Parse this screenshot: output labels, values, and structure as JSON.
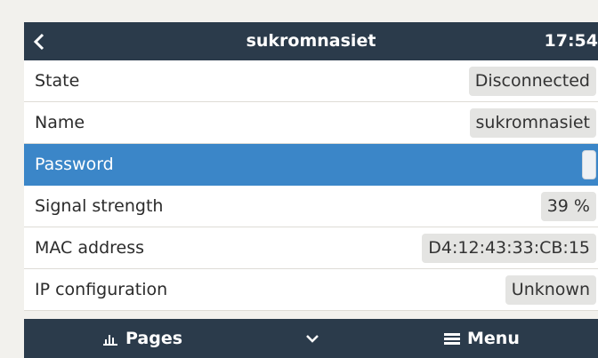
{
  "header": {
    "title": "sukromnasiet",
    "time": "17:54"
  },
  "rows": [
    {
      "label": "State",
      "value": "Disconnected"
    },
    {
      "label": "Name",
      "value": "sukromnasiet"
    },
    {
      "label": "Password",
      "value": ""
    },
    {
      "label": "Signal strength",
      "value": "39 %"
    },
    {
      "label": "MAC address",
      "value": "D4:12:43:33:CB:15"
    },
    {
      "label": "IP configuration",
      "value": "Unknown"
    }
  ],
  "footer": {
    "pages_label": "Pages",
    "menu_label": "Menu"
  },
  "icons": {
    "back": "chevron-left-icon",
    "pages": "bar-chart-icon",
    "scroll": "chevron-down-icon",
    "menu": "hamburger-icon"
  },
  "colors": {
    "header_bg": "#2b3b4b",
    "selected_row": "#3b86c8",
    "value_badge": "#e4e4e2"
  }
}
